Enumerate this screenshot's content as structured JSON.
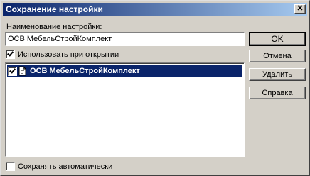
{
  "window": {
    "title": "Сохранение настройки",
    "close_label": "✕"
  },
  "form": {
    "name_label": "Наименование настройки:",
    "name_value": "ОСВ МебельСтройКомплект",
    "use_on_open_label": "Использовать при открытии",
    "use_on_open_checked": true,
    "auto_save_label": "Сохранять автоматически",
    "auto_save_checked": false
  },
  "list": {
    "items": [
      {
        "label": "ОСВ МебельСтройКомплект",
        "checked": true,
        "selected": true,
        "icon": "document-icon"
      }
    ]
  },
  "buttons": {
    "ok": "OK",
    "cancel": "Отмена",
    "delete": "Удалить",
    "help": "Справка"
  },
  "colors": {
    "title_gradient_start": "#0a246a",
    "title_gradient_end": "#a6caf0",
    "selection": "#0a246a",
    "face": "#d4d0c8"
  }
}
